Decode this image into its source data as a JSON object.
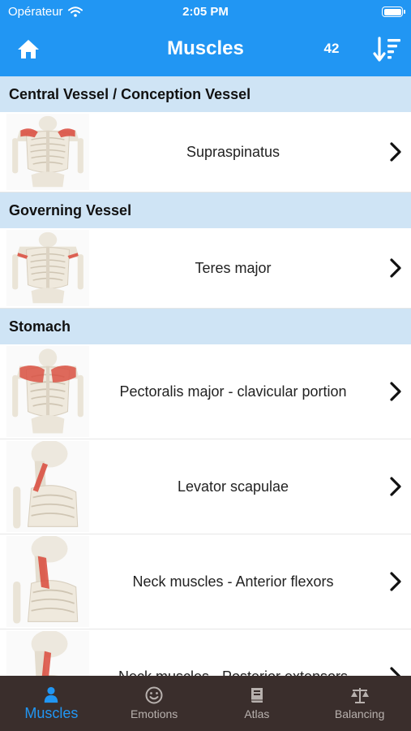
{
  "status_bar": {
    "carrier": "Opérateur",
    "time": "2:05 PM"
  },
  "header": {
    "title": "Muscles",
    "count": "42"
  },
  "colors": {
    "accent": "#2196f3",
    "section_bg": "#cfe4f5",
    "tabbar_bg": "#3a2e2c",
    "muscle_highlight": "#d9493b"
  },
  "sections": [
    {
      "title": "Central Vessel / Conception Vessel",
      "items": [
        {
          "label": "Supraspinatus",
          "image": "skeleton-torso-back-thumbnail"
        }
      ]
    },
    {
      "title": "Governing Vessel",
      "items": [
        {
          "label": "Teres major",
          "image": "skeleton-torso-back-thumbnail"
        }
      ]
    },
    {
      "title": "Stomach",
      "items": [
        {
          "label": "Pectoralis major - clavicular portion",
          "image": "skeleton-torso-front-thumbnail"
        },
        {
          "label": "Levator scapulae",
          "image": "skeleton-neck-side-thumbnail"
        },
        {
          "label": "Neck muscles - Anterior flexors",
          "image": "skeleton-neck-side-thumbnail"
        },
        {
          "label": "Neck muscles - Posterior extensors",
          "image": "skeleton-neck-side-thumbnail"
        }
      ]
    }
  ],
  "tabs": [
    {
      "label": "Muscles",
      "icon": "person-icon",
      "active": true
    },
    {
      "label": "Emotions",
      "icon": "smiley-icon",
      "active": false
    },
    {
      "label": "Atlas",
      "icon": "book-icon",
      "active": false
    },
    {
      "label": "Balancing",
      "icon": "scale-icon",
      "active": false
    }
  ]
}
